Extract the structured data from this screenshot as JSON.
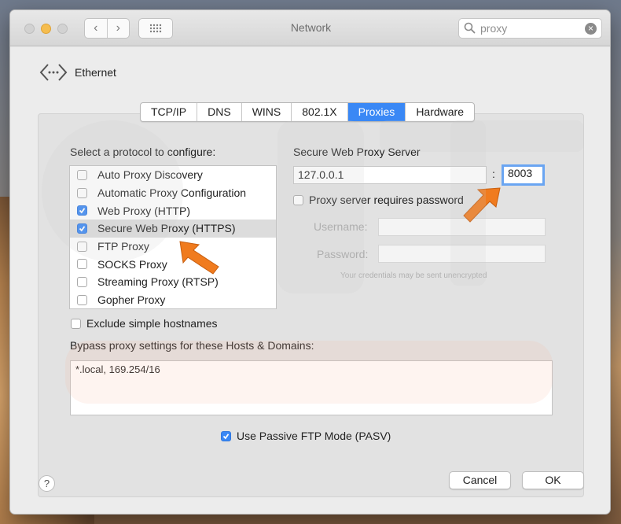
{
  "window": {
    "title": "Network"
  },
  "toolbar": {
    "back_symbol": "‹",
    "forward_symbol": "›"
  },
  "search": {
    "value": "proxy",
    "clear_symbol": "×"
  },
  "interface": {
    "name": "Ethernet"
  },
  "tabs": [
    {
      "label": "TCP/IP",
      "active": false
    },
    {
      "label": "DNS",
      "active": false
    },
    {
      "label": "WINS",
      "active": false
    },
    {
      "label": "802.1X",
      "active": false
    },
    {
      "label": "Proxies",
      "active": true
    },
    {
      "label": "Hardware",
      "active": false
    }
  ],
  "protocols": {
    "heading": "Select a protocol to configure:",
    "items": [
      {
        "label": "Auto Proxy Discovery",
        "checked": false,
        "selected": false
      },
      {
        "label": "Automatic Proxy Configuration",
        "checked": false,
        "selected": false
      },
      {
        "label": "Web Proxy (HTTP)",
        "checked": true,
        "selected": false
      },
      {
        "label": "Secure Web Proxy (HTTPS)",
        "checked": true,
        "selected": true
      },
      {
        "label": "FTP Proxy",
        "checked": false,
        "selected": false
      },
      {
        "label": "SOCKS Proxy",
        "checked": false,
        "selected": false
      },
      {
        "label": "Streaming Proxy (RTSP)",
        "checked": false,
        "selected": false
      },
      {
        "label": "Gopher Proxy",
        "checked": false,
        "selected": false
      }
    ]
  },
  "server": {
    "heading": "Secure Web Proxy Server",
    "address": "127.0.0.1",
    "separator": ":",
    "port": "8003",
    "requires_password_label": "Proxy server requires password",
    "requires_password": false,
    "username_label": "Username:",
    "username": "",
    "password_label": "Password:",
    "password": "",
    "note": "Your credentials may be sent unencrypted"
  },
  "exclude_simple": {
    "label": "Exclude simple hostnames",
    "checked": false
  },
  "bypass": {
    "label": "Bypass proxy settings for these Hosts & Domains:",
    "value": "*.local, 169.254/16"
  },
  "pasv": {
    "label": "Use Passive FTP Mode (PASV)",
    "checked": true
  },
  "buttons": {
    "help": "?",
    "cancel": "Cancel",
    "ok": "OK"
  },
  "colors": {
    "accent": "#3a88f5",
    "annotation_arrow": "#f07b1e"
  }
}
